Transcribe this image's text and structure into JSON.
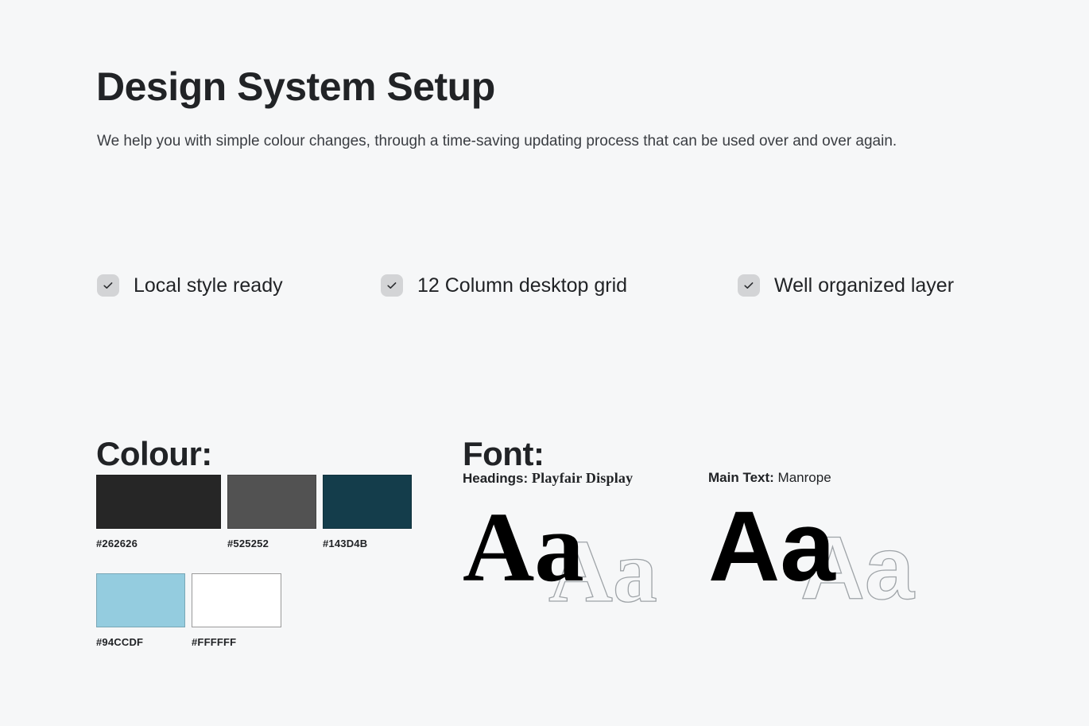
{
  "header": {
    "title": "Design System Setup",
    "subtitle": "We help you with simple colour changes, through a time-saving updating process that can be used over and over again."
  },
  "checklist": {
    "checkbox_icon": "check-icon",
    "items": [
      {
        "label": "Local style ready",
        "checked": true
      },
      {
        "label": "12 Column desktop grid",
        "checked": true
      },
      {
        "label": "Well organized layer",
        "checked": true
      }
    ]
  },
  "colour": {
    "heading": "Colour:",
    "swatches": [
      {
        "hex": "#262626",
        "value": "#262626",
        "bordered": false
      },
      {
        "hex": "#525252",
        "value": "#525252",
        "bordered": false
      },
      {
        "hex": "#143D4B",
        "value": "#143D4B",
        "bordered": false
      },
      {
        "hex": "#94CCDF",
        "value": "#94CCDF",
        "bordered": false
      },
      {
        "hex": "#FFFFFF",
        "value": "#FFFFFF",
        "bordered": true
      }
    ]
  },
  "font": {
    "heading": "Font:",
    "entries": [
      {
        "key": "Headings:",
        "value": "Playfair Display",
        "specimen_solid": "Aa",
        "specimen_outline": "Aa"
      },
      {
        "key": "Main Text:",
        "value": "Manrope",
        "specimen_solid": "Aa",
        "specimen_outline": "Aa"
      }
    ]
  },
  "theme": {
    "background": "#F6F7F8",
    "text": "#212326",
    "checkbox_fill": "#D3D4D6",
    "outline_stroke": "#9FA4A8",
    "swatch_border": "#9A9A9A"
  }
}
